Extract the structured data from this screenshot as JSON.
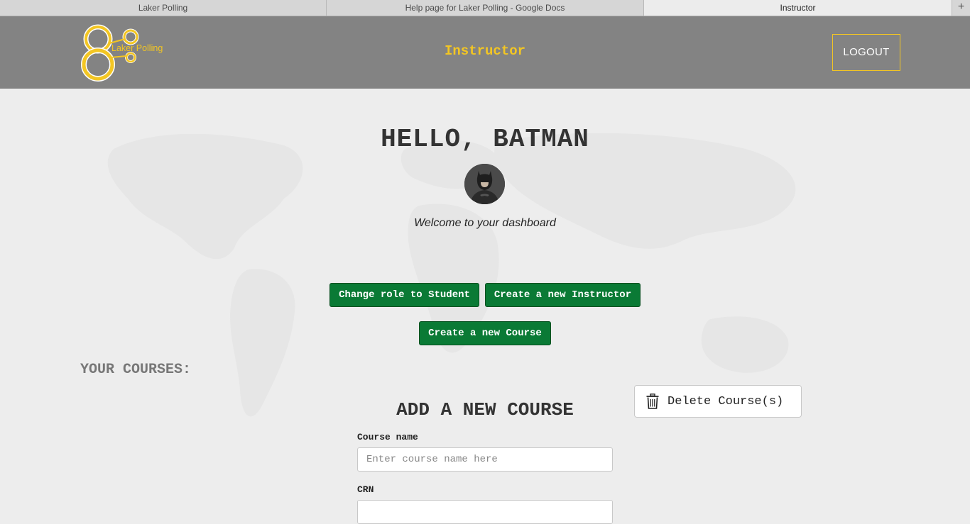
{
  "browser": {
    "tabs": [
      {
        "label": "Laker Polling"
      },
      {
        "label": "Help page for Laker Polling - Google Docs"
      },
      {
        "label": "Instructor"
      }
    ],
    "new_tab": "+"
  },
  "header": {
    "logo_text": "Laker Polling",
    "title": "Instructor",
    "logout_label": "LOGOUT"
  },
  "main": {
    "greeting": "HELLO, BATMAN",
    "welcome": "Welcome to your dashboard",
    "buttons": {
      "change_role": "Change role to Student",
      "new_instructor": "Create a new Instructor",
      "new_course": "Create a new Course"
    },
    "your_courses": "YOUR COURSES:",
    "delete_label": "Delete Course(s)",
    "form": {
      "title": "ADD A NEW COURSE",
      "course_name_label": "Course name",
      "course_name_placeholder": "Enter course name here",
      "crn_label": "CRN"
    }
  },
  "colors": {
    "header_bg": "#838383",
    "accent": "#f3c623",
    "button_green": "#0a7a35",
    "page_bg": "#ededed"
  }
}
